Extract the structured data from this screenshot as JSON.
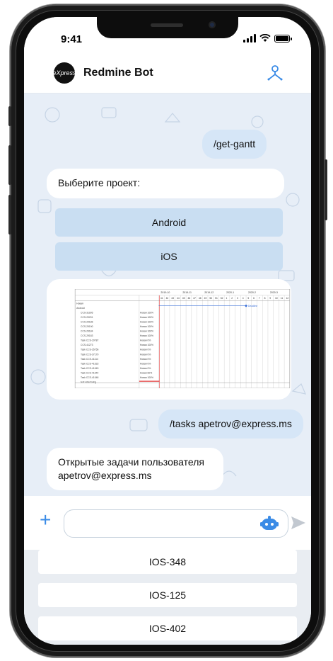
{
  "status_bar": {
    "time": "9:41"
  },
  "header": {
    "avatar_text": "eXpress",
    "title": "Redmine Bot"
  },
  "messages": {
    "cmd_gantt": "/get-gantt",
    "choose_project": "Выберите проект:",
    "project_buttons": [
      "Android",
      "iOS"
    ],
    "cmd_tasks": "/tasks apetrov@express.ms",
    "open_tasks": "Открытые задачи пользователя apetrov@express.ms"
  },
  "gantt": {
    "months": [
      "2019-10",
      "2019-11",
      "2019-12",
      "2020-1",
      "2020-2",
      "2020-3"
    ],
    "weeks": [
      "41",
      "42",
      "43",
      "44",
      "45",
      "46",
      "47",
      "48",
      "49",
      "50",
      "51",
      "52",
      "1",
      "2",
      "3",
      "4",
      "5",
      "6",
      "7",
      "8",
      "9",
      "10",
      "11",
      "12"
    ],
    "rows": [
      {
        "name": "Новая",
        "status": ""
      },
      {
        "name": "Android",
        "status": ""
      },
      {
        "name": "CCS-31005",
        "status": "Новая 100%"
      },
      {
        "name": "CCS-29291",
        "status": "Новая 100%"
      },
      {
        "name": "CCS-29186",
        "status": "Новая 100%"
      },
      {
        "name": "CCS-29190",
        "status": "Новая 100%"
      },
      {
        "name": "CCS-29184",
        "status": "Новая 100%"
      },
      {
        "name": "CCS-29183",
        "status": "Новая 100%"
      },
      {
        "name": "Task CCS-29787",
        "status": "Новая 0%"
      },
      {
        "name": "CCS-41273",
        "status": "Новая 100%"
      },
      {
        "name": "Task CCS-35756",
        "status": "Новая 0%"
      },
      {
        "name": "Task CCS-37179",
        "status": "Новая 0%"
      },
      {
        "name": "Task CCS-41114",
        "status": "Новая 0%"
      },
      {
        "name": "Task CCS-41023",
        "status": "Новая 0%"
      },
      {
        "name": "Task CCS-41043",
        "status": "Новая 0%"
      },
      {
        "name": "Task CCS-41044",
        "status": "Новая 60%"
      },
      {
        "name": "Task CCS-41048",
        "status": "Новая 100%"
      },
      {
        "name": "test refactoring",
        "status": ""
      }
    ],
    "milestone": "Deadline"
  },
  "input": {
    "placeholder": ""
  },
  "replies": [
    "IOS-348",
    "IOS-125",
    "IOS-402"
  ],
  "colors": {
    "accent": "#3a8be6",
    "out_bubble": "#d6e6f7",
    "bot_button": "#c9def2",
    "chat_bg": "#e7eef7"
  },
  "icons": [
    "plus-icon",
    "bot-face-icon",
    "send-icon",
    "people-icon",
    "wifi-icon",
    "battery-icon",
    "signal-icon"
  ]
}
